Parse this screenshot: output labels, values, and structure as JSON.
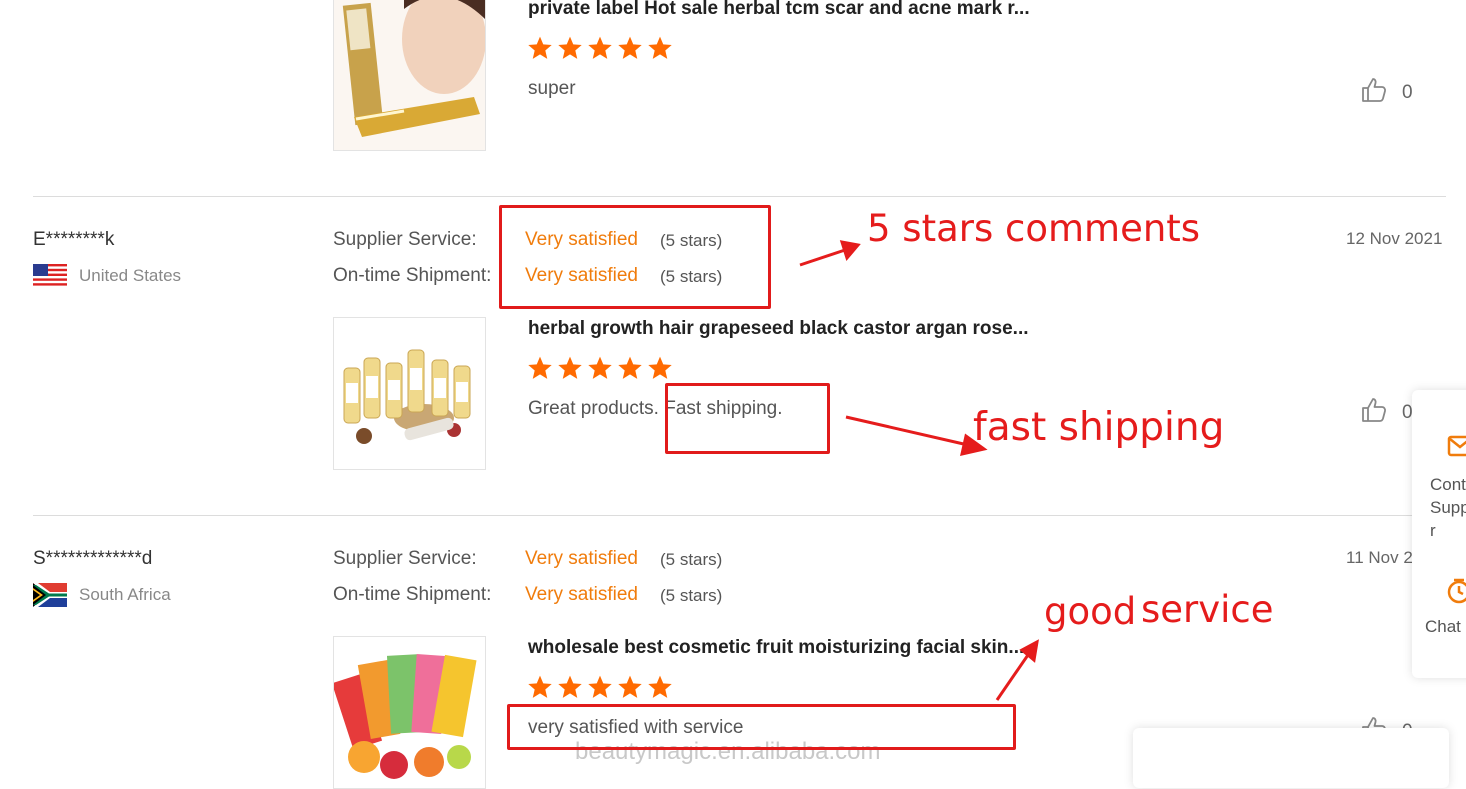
{
  "reviews": [
    {
      "product_title": "private label Hot sale herbal tcm scar and acne mark r...",
      "rating": 5,
      "comment": "super",
      "likes": "0",
      "thumb_icon": "acne-cream-product-image"
    },
    {
      "reviewer": "E********k",
      "country": "United States",
      "flag_icon": "us-flag-icon",
      "date": "12 Nov 2021",
      "supplier_service_label": "Supplier Service:",
      "supplier_service_value": "Very satisfied",
      "supplier_service_stars": "(5 stars)",
      "shipment_label": "On-time Shipment:",
      "shipment_value": "Very satisfied",
      "shipment_stars": "(5 stars)",
      "product_title": "herbal growth hair grapeseed black castor argan rose...",
      "rating": 5,
      "comment_part1": "Great products.",
      "comment_part2": "Fast shipping.",
      "likes": "0",
      "thumb_icon": "hair-oil-bottles-product-image"
    },
    {
      "reviewer": "S*************d",
      "country": "South Africa",
      "flag_icon": "south-africa-flag-icon",
      "date": "11 Nov 2",
      "supplier_service_label": "Supplier Service:",
      "supplier_service_value": "Very satisfied",
      "supplier_service_stars": "(5 stars)",
      "shipment_label": "On-time Shipment:",
      "shipment_value": "Very satisfied",
      "shipment_stars": "(5 stars)",
      "product_title": "wholesale best cosmetic fruit moisturizing facial skin...",
      "rating": 5,
      "comment": "very satisfied with service",
      "likes": "0",
      "thumb_icon": "facial-mask-product-image"
    }
  ],
  "annotations": {
    "stars_comments": "5 stars comments",
    "fast_shipping": "fast shipping",
    "good": "good",
    "service": "service",
    "color": "#e51c1c"
  },
  "side_panel": {
    "contact_lines": [
      "Cont",
      "Supp",
      "r"
    ],
    "chat": "Chat",
    "mail_icon": "mail-icon",
    "chat_icon": "chat-clock-icon"
  },
  "watermark": "beautymagic.en.alibaba.com",
  "colors": {
    "accent": "#f07c0c",
    "star": "#ff6a00",
    "annotation": "#e51c1c"
  }
}
